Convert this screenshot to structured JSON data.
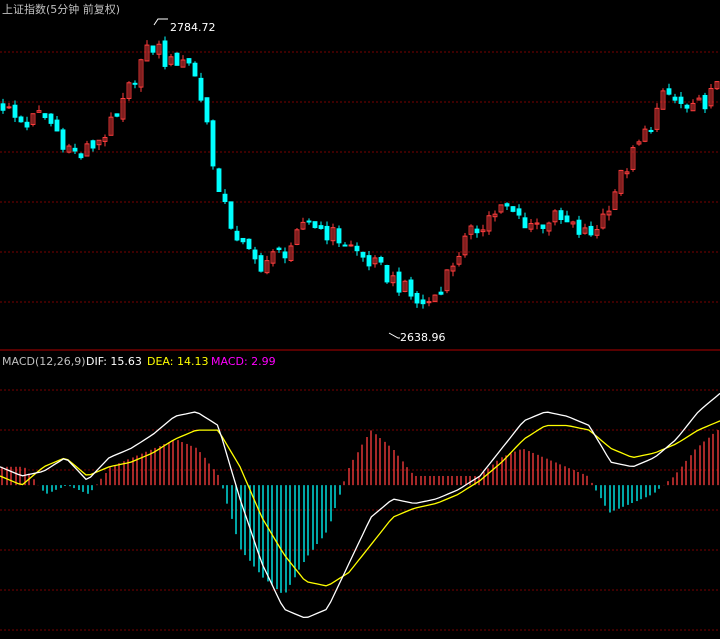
{
  "title": "上证指数(5分钟 前复权)",
  "price_high_label": "2784.72",
  "price_low_label": "2638.96",
  "macd_panel": {
    "label": "MACD(12,26,9)",
    "dif_label": "DIF: 15.63",
    "dea_label": "DEA: 14.13",
    "macd_label": "MACD: 2.99"
  },
  "colors": {
    "background": "#000000",
    "up": "#ff3d3d",
    "down": "#00ffff",
    "dif": "#ffffff",
    "dea": "#ffff00",
    "macd_text": "#ff00ff",
    "grid": "#7a0000",
    "label_text": "#c0c0c0"
  },
  "chart_data": [
    {
      "type": "candlestick",
      "title": "上证指数(5分钟 前复权)",
      "grid": true,
      "high_annotation": 2784.72,
      "low_annotation": 2638.96,
      "close_path": [
        2750,
        2742,
        2740,
        2745,
        2738,
        2728,
        2722,
        2728,
        2735,
        2742,
        2760,
        2775,
        2782,
        2770,
        2776,
        2768,
        2740,
        2700,
        2685,
        2672,
        2665,
        2668,
        2672,
        2678,
        2688,
        2684,
        2680,
        2676,
        2670,
        2665,
        2660,
        2655,
        2648,
        2643,
        2650,
        2662,
        2675,
        2683,
        2690,
        2695,
        2692,
        2688,
        2686,
        2690,
        2687,
        2683,
        2680,
        2690,
        2705,
        2718,
        2730,
        2742,
        2756,
        2750,
        2745,
        2752,
        2758
      ]
    },
    {
      "type": "macd",
      "title": "MACD(12,26,9)",
      "series": [
        {
          "name": "DIF",
          "last": 15.63
        },
        {
          "name": "DEA",
          "last": 14.13
        },
        {
          "name": "MACD",
          "last": 2.99
        }
      ],
      "dif_path": [
        4,
        2,
        3,
        6,
        1,
        6,
        8,
        11,
        15,
        16,
        13,
        -3,
        -17,
        -27,
        -29,
        -27,
        -17,
        -7,
        -3,
        -4,
        -3,
        -1,
        2,
        8,
        14,
        16,
        15,
        13,
        5,
        4,
        6,
        10,
        16,
        20
      ],
      "dea_path": [
        2,
        0,
        4,
        6,
        2,
        4,
        5,
        7,
        10,
        12,
        12,
        4,
        -7,
        -15,
        -21,
        -22,
        -19,
        -13,
        -7,
        -5,
        -4,
        -2,
        1,
        5,
        10,
        13,
        13,
        12,
        8,
        6,
        7,
        9,
        12,
        14
      ]
    }
  ]
}
